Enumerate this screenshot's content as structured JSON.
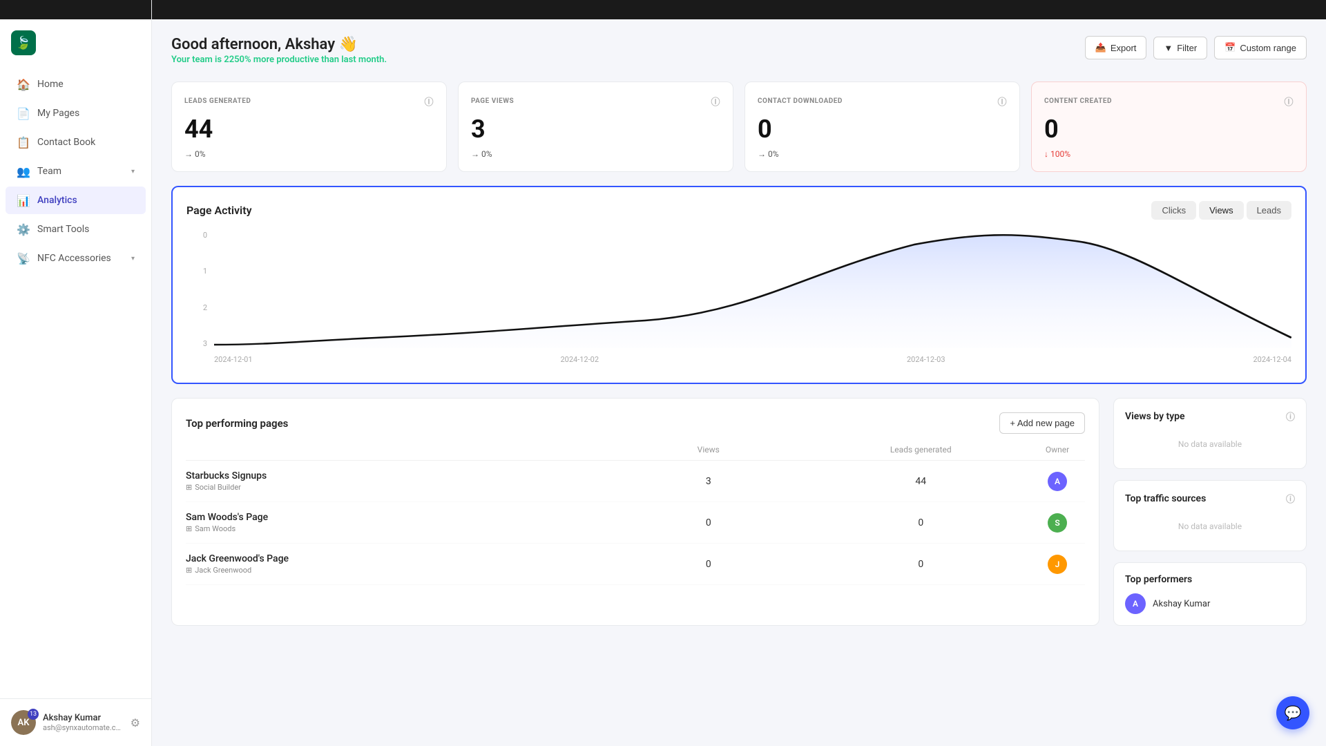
{
  "topBar": {
    "bg": "#1a1a1a"
  },
  "sidebar": {
    "logo": "🍃",
    "nav": [
      {
        "id": "home",
        "label": "Home",
        "icon": "🏠",
        "active": false
      },
      {
        "id": "my-pages",
        "label": "My Pages",
        "icon": "📄",
        "active": false
      },
      {
        "id": "contact-book",
        "label": "Contact Book",
        "icon": "📋",
        "active": false
      },
      {
        "id": "team",
        "label": "Team",
        "icon": "👥",
        "active": false,
        "hasChevron": true
      },
      {
        "id": "analytics",
        "label": "Analytics",
        "icon": "📊",
        "active": true
      },
      {
        "id": "smart-tools",
        "label": "Smart Tools",
        "icon": "⚙️",
        "active": false
      },
      {
        "id": "nfc-accessories",
        "label": "NFC Accessories",
        "icon": "📡",
        "active": false,
        "hasChevron": true
      }
    ],
    "user": {
      "name": "Akshay Kumar",
      "email": "ash@synxautomate.com",
      "badge": "13",
      "initials": "AK"
    }
  },
  "header": {
    "greeting": "Good afternoon, Akshay 👋",
    "subtext": "Your team is",
    "highlight": "2250% more",
    "highlight_suffix": "productive than last month.",
    "actions": {
      "export": "Export",
      "filter": "Filter",
      "custom_range": "Custom range"
    }
  },
  "stats": [
    {
      "id": "leads-generated",
      "label": "LEADS GENERATED",
      "value": "44",
      "change": "→ 0%",
      "negative": false
    },
    {
      "id": "page-views",
      "label": "PAGE VIEWS",
      "value": "3",
      "change": "→ 0%",
      "negative": false
    },
    {
      "id": "contact-downloaded",
      "label": "CONTACT DOWNLOADED",
      "value": "0",
      "change": "→ 0%",
      "negative": false
    },
    {
      "id": "content-created",
      "label": "CONTENT CREATED",
      "value": "0",
      "change": "↓ 100%",
      "negative": true
    }
  ],
  "chart": {
    "title": "Page Activity",
    "tabs": [
      "Clicks",
      "Views",
      "Leads"
    ],
    "activeTab": "Views",
    "yLabels": [
      "0",
      "1",
      "2",
      "3"
    ],
    "xLabels": [
      "2024-12-01",
      "2024-12-02",
      "2024-12-03",
      "2024-12-04"
    ]
  },
  "topPages": {
    "title": "Top performing pages",
    "addBtn": "+ Add new page",
    "columns": [
      "Views",
      "Leads generated",
      "Owner"
    ],
    "rows": [
      {
        "name": "Starbucks Signups",
        "sub": "Social Builder",
        "views": "3",
        "leads": "44",
        "ownerInitial": "A",
        "ownerColor": "#6c63ff"
      },
      {
        "name": "Sam Woods's Page",
        "sub": "Sam Woods",
        "views": "0",
        "leads": "0",
        "ownerInitial": "S",
        "ownerColor": "#4caf50"
      },
      {
        "name": "Jack Greenwood's Page",
        "sub": "Jack Greenwood",
        "views": "0",
        "leads": "0",
        "ownerInitial": "J",
        "ownerColor": "#ff9800"
      }
    ]
  },
  "viewsByType": {
    "title": "Views by type",
    "noData": "No data available"
  },
  "topTrafficSources": {
    "title": "Top traffic sources",
    "noData": "No data available"
  },
  "topPerformers": {
    "title": "Top performers",
    "items": [
      {
        "name": "Akshay Kumar",
        "initial": "A"
      }
    ]
  }
}
